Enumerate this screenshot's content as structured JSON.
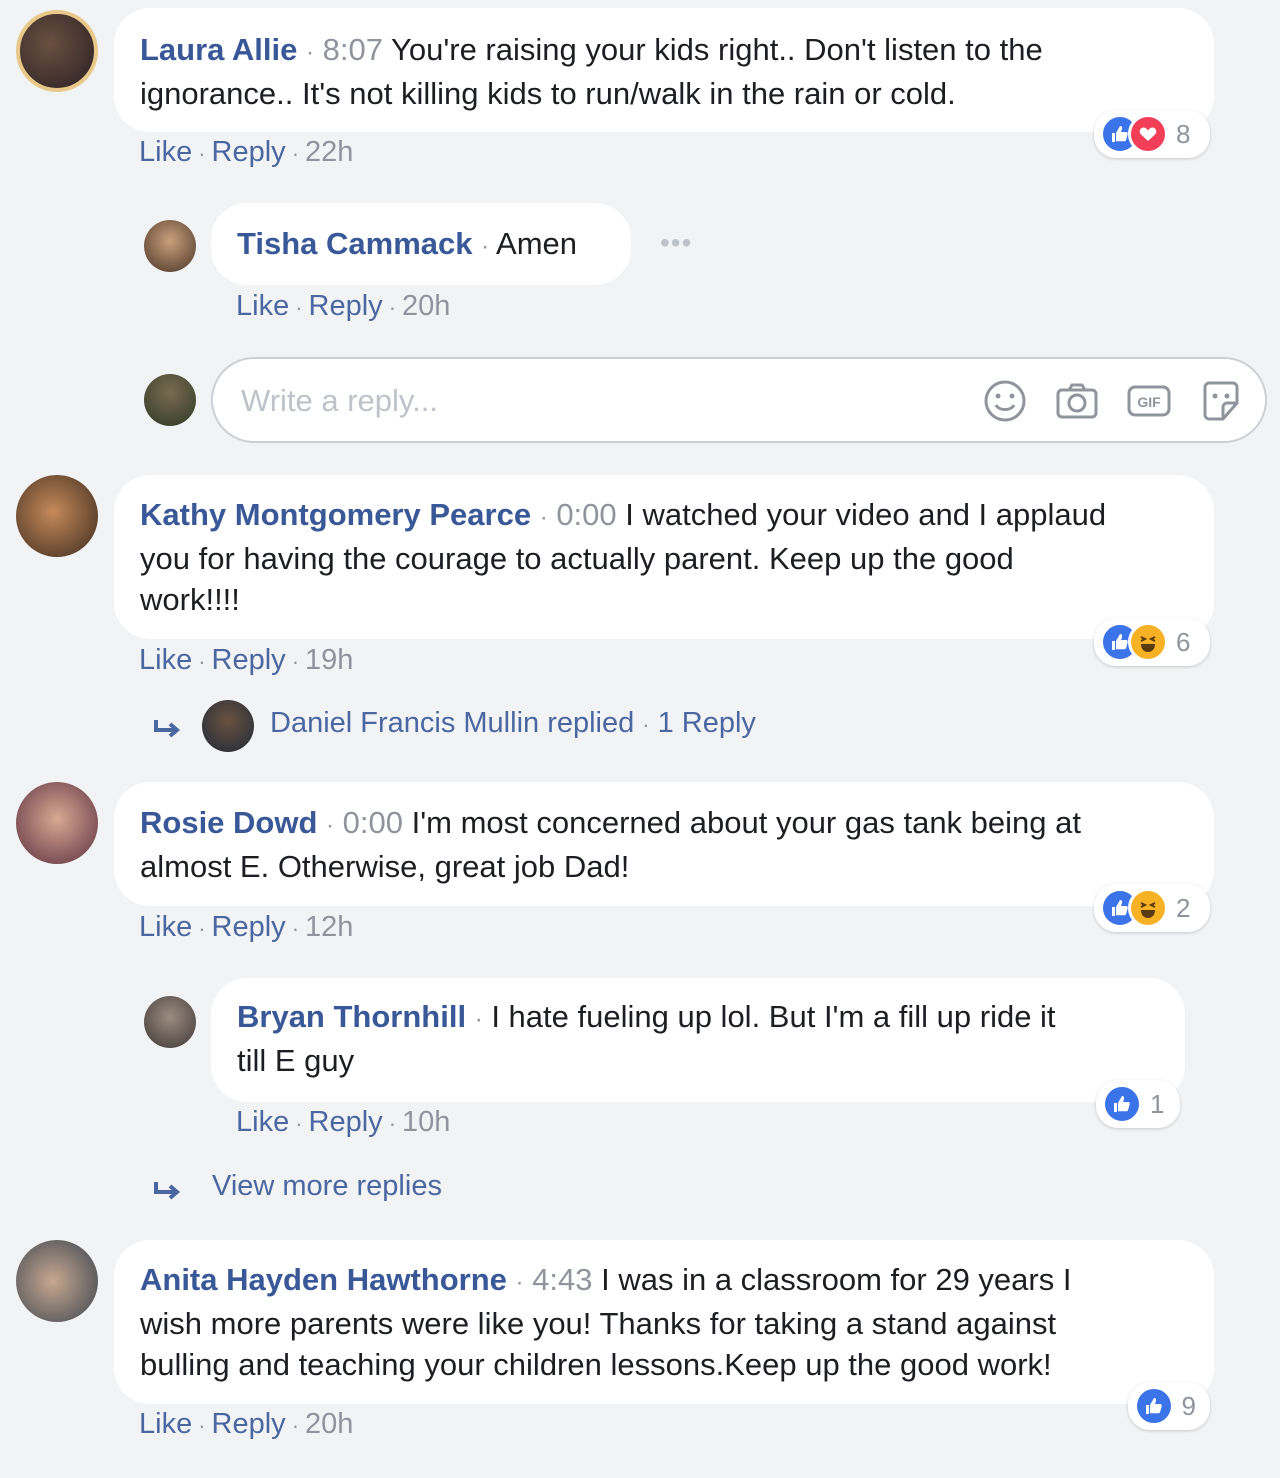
{
  "colors": {
    "background": "#f2f3f5",
    "name_link": "#385898",
    "action_link": "#4b67a1",
    "muted": "#90949c",
    "like_blue": "#3b73e8",
    "love_red": "#f33e58",
    "haha_yellow": "#f7b125"
  },
  "action_labels": {
    "like": "Like",
    "reply": "Reply",
    "sep": "·"
  },
  "comments": [
    {
      "author": "Laura Allie",
      "timestamp": "8:07",
      "line1": "You're raising your kids right.. Don't listen to the",
      "line2": "ignorance.. It's not killing kids to run/walk in the rain or cold.",
      "age": "22h",
      "reactions": [
        "like-icon",
        "love-icon"
      ],
      "reaction_count": "8"
    },
    {
      "author": "Kathy Montgomery Pearce",
      "timestamp": "0:00",
      "line1": "I watched your video and I applaud",
      "line2": "you for having the courage to actually parent. Keep up the good",
      "line3": "work!!!!",
      "age": "19h",
      "reactions": [
        "like-icon",
        "haha-icon"
      ],
      "reaction_count": "6"
    },
    {
      "author": "Rosie Dowd",
      "timestamp": "0:00",
      "line1": "I'm most concerned about your gas tank being at",
      "line2": "almost E. Otherwise, great job Dad!",
      "age": "12h",
      "reactions": [
        "like-icon",
        "haha-icon"
      ],
      "reaction_count": "2"
    },
    {
      "author": "Anita Hayden Hawthorne",
      "timestamp": "4:43",
      "line1": "I was in a classroom for 29 years I",
      "line2": "wish more parents were like you! Thanks for taking a stand against",
      "line3": "bulling and teaching your children lessons.Keep up the good work!",
      "age": "20h",
      "reactions": [
        "like-icon"
      ],
      "reaction_count": "9"
    }
  ],
  "replies": [
    {
      "author": "Tisha Cammack",
      "text": "Amen",
      "age": "20h",
      "more": "•••"
    },
    {
      "author": "Bryan Thornhill",
      "line1": "I hate fueling up lol. But I'm a fill up ride it",
      "line2": "till E guy",
      "age": "10h",
      "reactions": [
        "like-icon"
      ],
      "reaction_count": "1"
    }
  ],
  "composer": {
    "placeholder": "Write a reply...",
    "icons": [
      "emoji-icon",
      "camera-icon",
      "gif-icon",
      "sticker-icon"
    ],
    "gif_label": "GIF"
  },
  "collapsed_reply": {
    "text": "Daniel Francis Mullin replied",
    "count": "1 Reply"
  },
  "view_more": "View more replies"
}
